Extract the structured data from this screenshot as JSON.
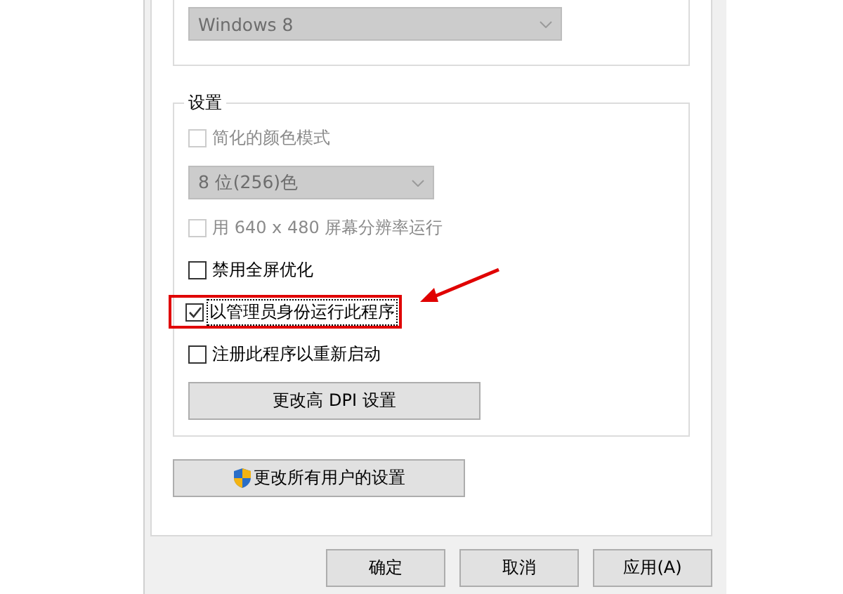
{
  "compat_group": {
    "dropdown": {
      "value": "Windows 8",
      "disabled": true
    }
  },
  "settings": {
    "title": "设置",
    "items": [
      {
        "kind": "checkbox",
        "label": "简化的颜色模式",
        "checked": false,
        "disabled": true
      },
      {
        "kind": "dropdown",
        "value": "8 位(256)色",
        "disabled": true
      },
      {
        "kind": "checkbox",
        "label": "用 640 x 480 屏幕分辨率运行",
        "checked": false,
        "disabled": true
      },
      {
        "kind": "checkbox",
        "label": "禁用全屏优化",
        "checked": false,
        "disabled": false
      },
      {
        "kind": "checkbox",
        "label": "以管理员身份运行此程序",
        "checked": true,
        "disabled": false,
        "focused": true,
        "annotated": true
      },
      {
        "kind": "checkbox",
        "label": "注册此程序以重新启动",
        "checked": false,
        "disabled": false
      },
      {
        "kind": "button",
        "label": "更改高 DPI 设置"
      }
    ]
  },
  "all_users_button": {
    "label": "更改所有用户的设置"
  },
  "buttons": [
    {
      "label": "确定"
    },
    {
      "label": "取消"
    },
    {
      "label": "应用(A)"
    }
  ]
}
